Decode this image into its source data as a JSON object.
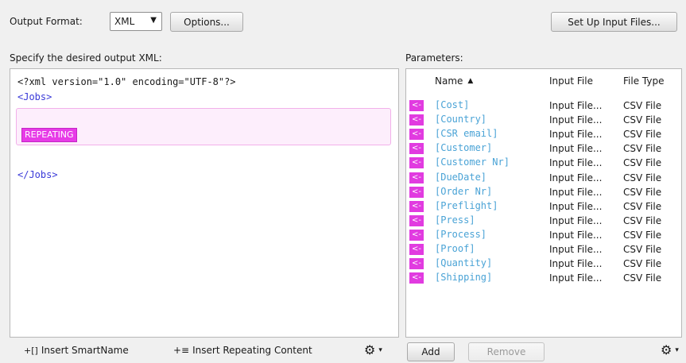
{
  "toolbar": {
    "output_format_label": "Output Format:",
    "output_format_value": "XML",
    "options_button": "Options...",
    "setup_input_button": "Set Up Input Files..."
  },
  "left_panel": {
    "title": "Specify the desired output XML:",
    "xml_decl": "<?xml version=\"1.0\" encoding=\"UTF-8\"?>",
    "open_tag": "<Jobs>",
    "repeating_label": "REPEATING",
    "close_tag": "</Jobs>",
    "insert_smartname": "Insert SmartName",
    "insert_repeating": "Insert Repeating Content"
  },
  "right_panel": {
    "title": "Parameters:",
    "headers": {
      "name": "Name",
      "input_file": "Input File",
      "file_type": "File Type"
    },
    "badge": "<-",
    "rows": [
      {
        "name": "[Cost]",
        "input_file": "Input File...",
        "file_type": "CSV File"
      },
      {
        "name": "[Country]",
        "input_file": "Input File...",
        "file_type": "CSV File"
      },
      {
        "name": "[CSR email]",
        "input_file": "Input File...",
        "file_type": "CSV File"
      },
      {
        "name": "[Customer]",
        "input_file": "Input File...",
        "file_type": "CSV File"
      },
      {
        "name": "[Customer Nr]",
        "input_file": "Input File...",
        "file_type": "CSV File"
      },
      {
        "name": "[DueDate]",
        "input_file": "Input File...",
        "file_type": "CSV File"
      },
      {
        "name": "[Order Nr]",
        "input_file": "Input File...",
        "file_type": "CSV File"
      },
      {
        "name": "[Preflight]",
        "input_file": "Input File...",
        "file_type": "CSV File"
      },
      {
        "name": "[Press]",
        "input_file": "Input File...",
        "file_type": "CSV File"
      },
      {
        "name": "[Process]",
        "input_file": "Input File...",
        "file_type": "CSV File"
      },
      {
        "name": "[Proof]",
        "input_file": "Input File...",
        "file_type": "CSV File"
      },
      {
        "name": "[Quantity]",
        "input_file": "Input File...",
        "file_type": "CSV File"
      },
      {
        "name": "[Shipping]",
        "input_file": "Input File...",
        "file_type": "CSV File"
      }
    ],
    "add_button": "Add",
    "remove_button": "Remove"
  },
  "colors": {
    "accent_magenta": "#e13be0",
    "param_name": "#4aa3d6",
    "xml_tag": "#3a3ad8"
  }
}
